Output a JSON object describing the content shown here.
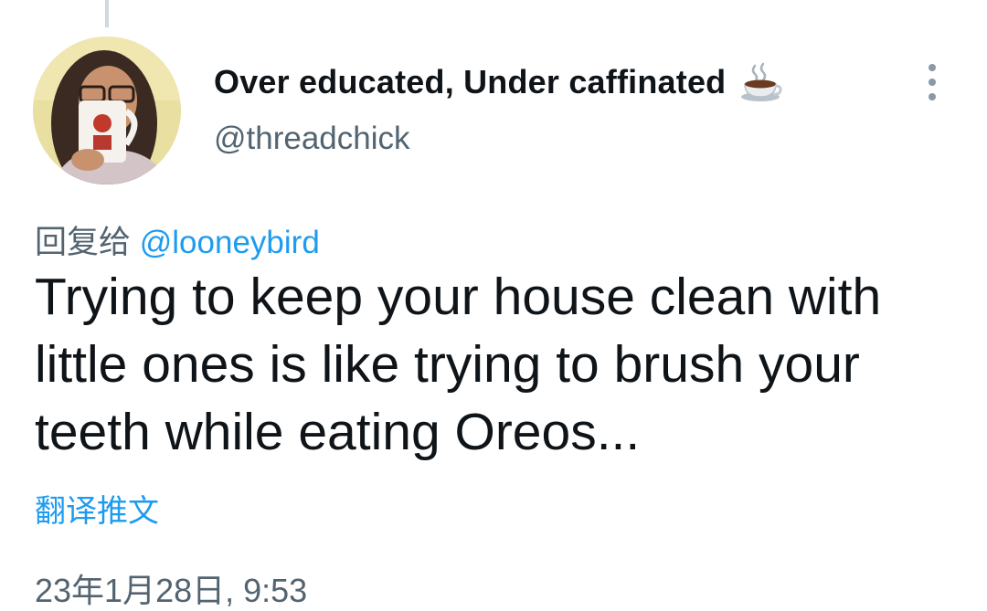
{
  "author": {
    "display_name": "Over educated, Under caffinated",
    "name_emoji": "coffee-cup-icon",
    "handle": "@threadchick",
    "avatar": "avatar-photo"
  },
  "reply": {
    "prefix": "回复给",
    "mention": "@looneybird"
  },
  "tweet": {
    "text": "Trying to keep your house clean with little ones is like trying to brush your teeth while eating Oreos..."
  },
  "translate_label": "翻译推文",
  "timestamp": "23年1月28日, 9:53",
  "menu_icon": "more-vertical-icon",
  "colors": {
    "text_primary": "#0f1419",
    "text_secondary": "#536471",
    "accent": "#1d9bf0"
  }
}
